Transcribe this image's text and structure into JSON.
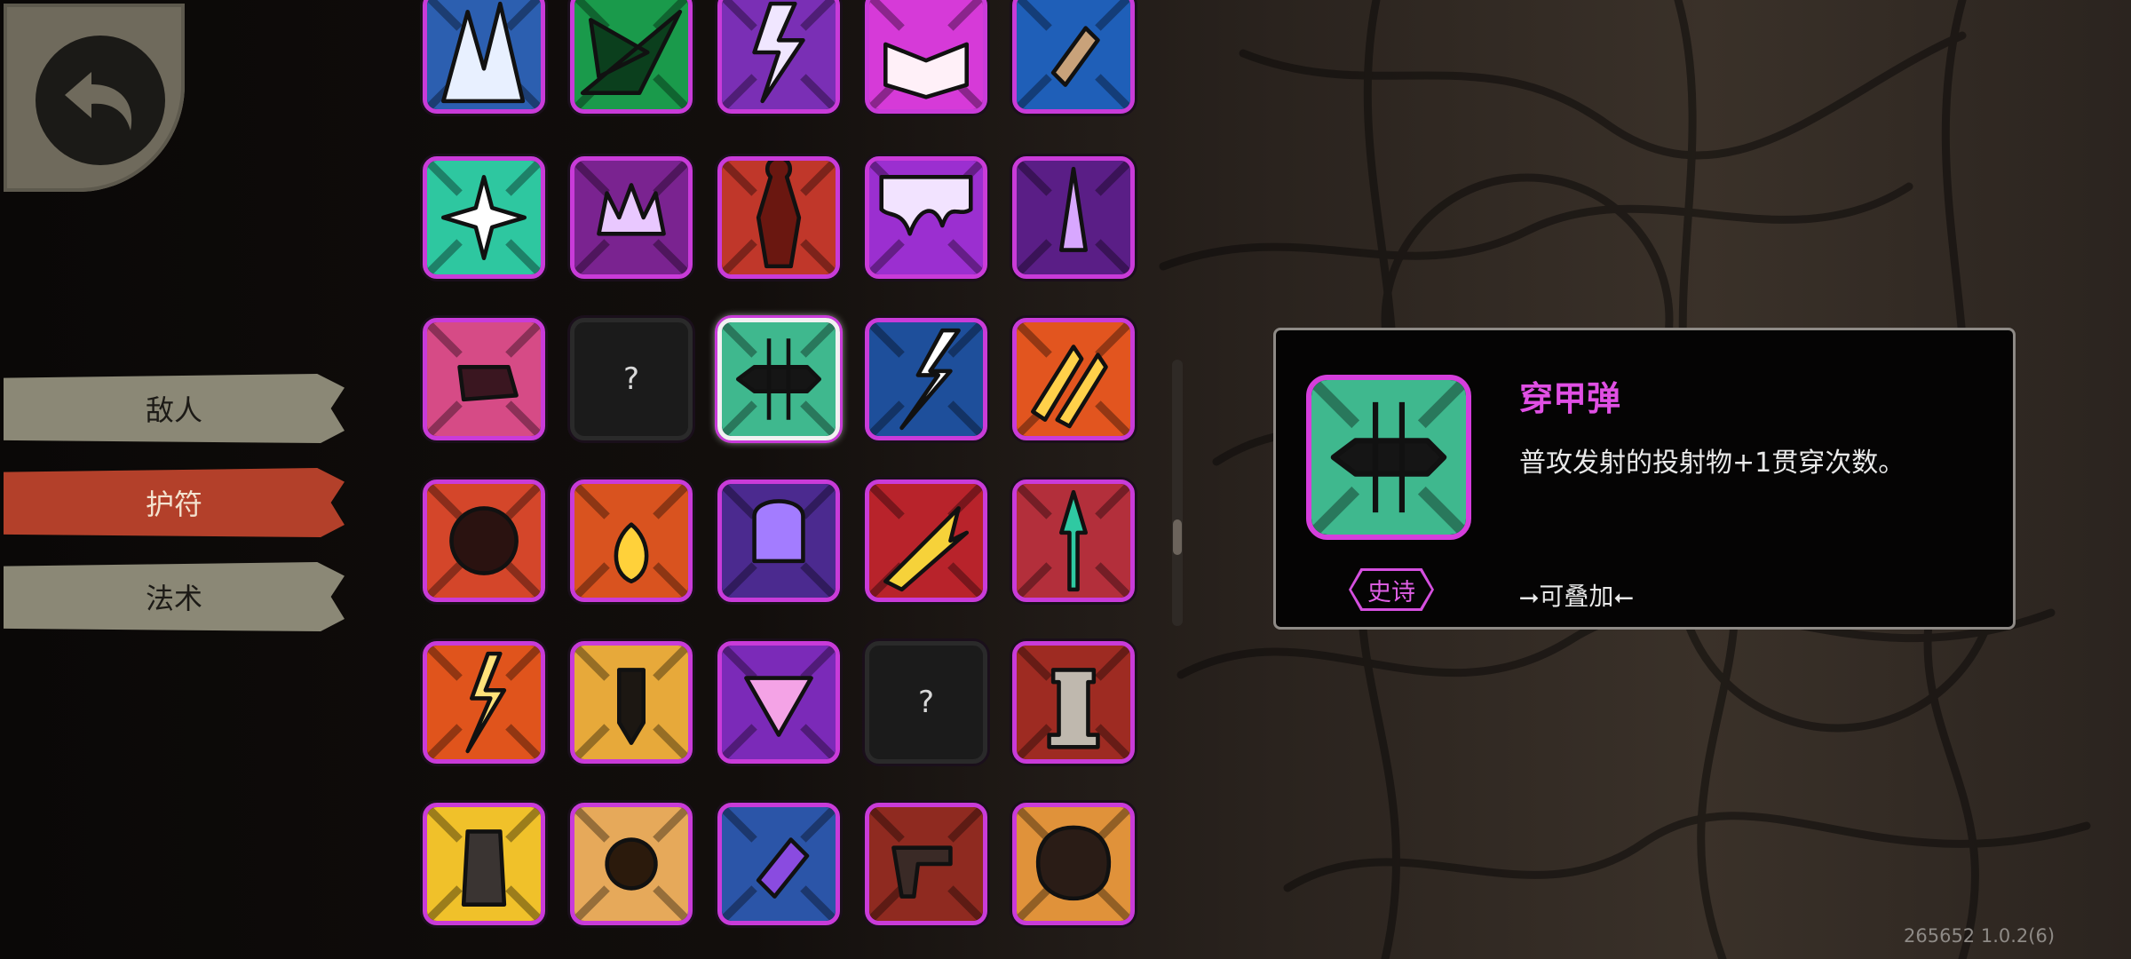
{
  "tabs": [
    {
      "label": "敌人",
      "active": false
    },
    {
      "label": "护符",
      "active": true
    },
    {
      "label": "法术",
      "active": false
    }
  ],
  "grid": {
    "unknown_label": "?",
    "rows": [
      [
        "blue-crystal-icon",
        "green-shard-icon",
        "purple-lightning-icon",
        "spellbook-icon",
        "blue-bullet-icon"
      ],
      [
        "teal-burst-icon",
        "demon-crown-icon",
        "red-body-icon",
        "purple-slime-icon",
        "purple-spike-icon"
      ],
      [
        "pink-fist-icon",
        "unknown",
        "armor-piercing-bullet-icon",
        "blue-lightning-icon",
        "orange-claw-icon"
      ],
      [
        "crosshair-icon",
        "fire-ring-icon",
        "purple-skull-icon",
        "yellow-arrow-icon",
        "teal-spear-icon"
      ],
      [
        "orange-lightning-icon",
        "ammo-drop-icon",
        "warning-triangle-icon",
        "unknown",
        "red-pillar-icon"
      ],
      [
        "yellow-magazine-icon",
        "orange-vortex-icon",
        "purple-capsule-icon",
        "red-pistols-icon",
        "orange-explosion-icon"
      ]
    ]
  },
  "detail": {
    "icon": "armor-piercing-bullet-icon",
    "name": "穿甲弹",
    "description": "普攻发射的投射物+1贯穿次数。",
    "rarity": "史诗",
    "stackable": "⭢可叠加⭠"
  },
  "version": "265652 1.0.2(6)",
  "colors": {
    "epic_border": "#c93bd9",
    "active_tab": "#b3402a",
    "inactive_tab": "#8b8876",
    "title": "#e04fe4"
  }
}
